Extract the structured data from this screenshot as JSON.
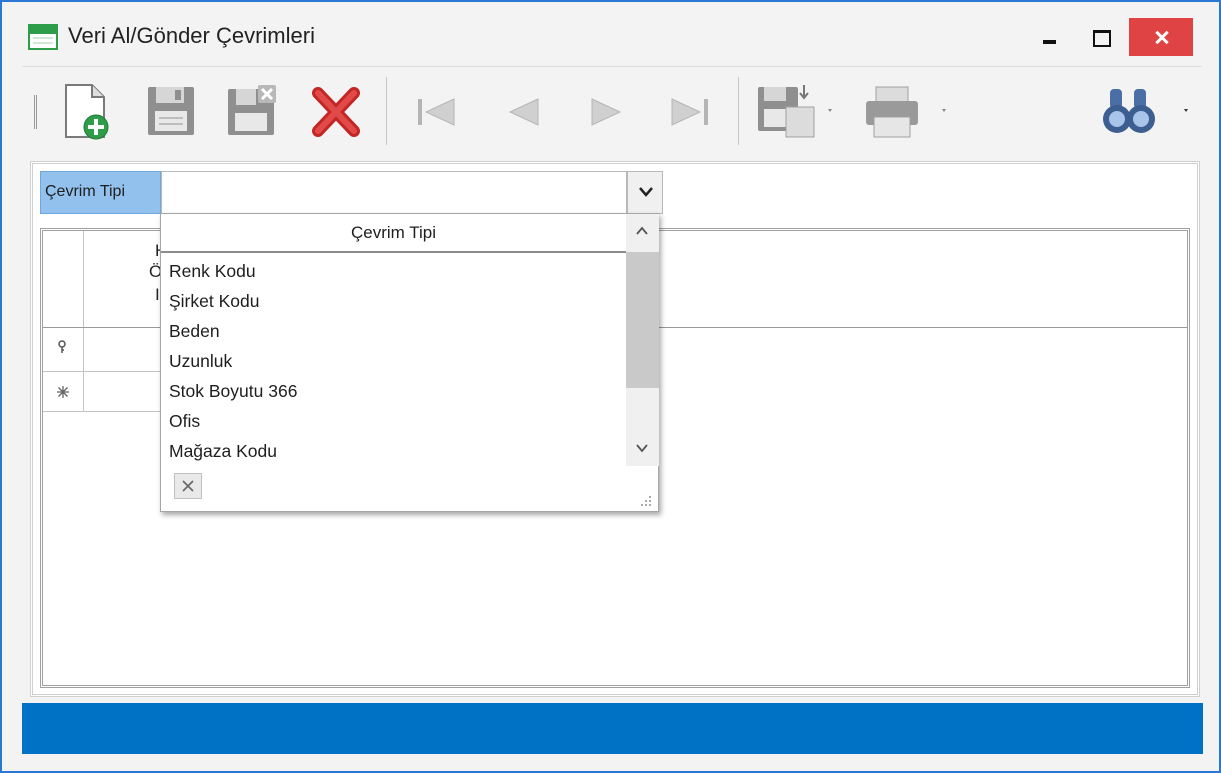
{
  "window": {
    "title": "Veri Al/Gönder Çevrimleri"
  },
  "toolbar": {
    "buttons": [
      "new-record",
      "save",
      "save-and-close",
      "delete",
      "first-record",
      "previous-record",
      "next-record",
      "last-record",
      "export",
      "print",
      "search"
    ]
  },
  "lookup": {
    "label": "Çevrim Tipi",
    "value": ""
  },
  "popup": {
    "header": "Çevrim Tipi",
    "items": [
      "Renk Kodu",
      "Şirket Kodu",
      "Beden",
      "Uzunluk",
      "Stok Boyutu 366",
      "Ofis",
      "Mağaza Kodu"
    ]
  },
  "grid": {
    "header_fragments": [
      "H",
      "Ö",
      "I"
    ],
    "row_indicators": [
      "key-icon",
      "new-row-icon"
    ]
  },
  "colors": {
    "accent": "#0072c6",
    "lookup_label_bg": "#92c1ed",
    "close_button": "#e04343"
  }
}
